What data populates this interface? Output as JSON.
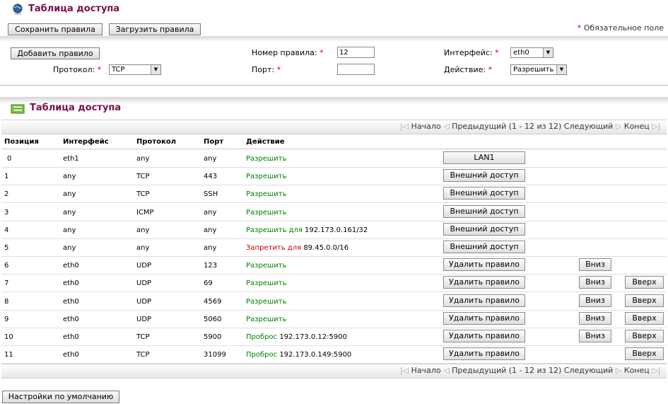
{
  "header": {
    "title": "Таблица доступа",
    "save_label": "Сохранить правила",
    "load_label": "Загрузить правила",
    "required_note": "Обязательное поле"
  },
  "form": {
    "add_label": "Добавить правило",
    "rule_number_label": "Номер правила:",
    "rule_number_value": "12",
    "interface_label": "Интерфейс:",
    "interface_value": "eth0",
    "protocol_label": "Протокол:",
    "protocol_value": "TCP",
    "port_label": "Порт:",
    "port_value": "",
    "action_label": "Действие:",
    "action_value": "Разрешить"
  },
  "table": {
    "title": "Таблица доступа",
    "pager": {
      "first": "Начало",
      "prev": "Предыдущий",
      "range": "(1 - 12 из 12)",
      "next": "Следующий",
      "last": "Конец"
    },
    "columns": [
      "Позиция",
      "Интерфейс",
      "Протокол",
      "Порт",
      "Действие"
    ],
    "rows": [
      {
        "pos": "0",
        "iface": "eth1",
        "proto": "any",
        "port": "any",
        "action": "Разрешить",
        "detail": "",
        "deny": false,
        "main_btn": "LAN1",
        "down": "",
        "up": ""
      },
      {
        "pos": "1",
        "iface": "any",
        "proto": "TCP",
        "port": "443",
        "action": "Разрешить",
        "detail": "",
        "deny": false,
        "main_btn": "Внешний доступ",
        "down": "",
        "up": ""
      },
      {
        "pos": "2",
        "iface": "any",
        "proto": "TCP",
        "port": "SSH",
        "action": "Разрешить",
        "detail": "",
        "deny": false,
        "main_btn": "Внешний доступ",
        "down": "",
        "up": ""
      },
      {
        "pos": "3",
        "iface": "any",
        "proto": "ICMP",
        "port": "any",
        "action": "Разрешить",
        "detail": "",
        "deny": false,
        "main_btn": "Внешний доступ",
        "down": "",
        "up": ""
      },
      {
        "pos": "4",
        "iface": "any",
        "proto": "any",
        "port": "any",
        "action": "Разрешить для",
        "detail": "192.173.0.161/32",
        "deny": false,
        "main_btn": "Внешний доступ",
        "down": "",
        "up": ""
      },
      {
        "pos": "5",
        "iface": "any",
        "proto": "any",
        "port": "any",
        "action": "Запретить для",
        "detail": "89.45.0.0/16",
        "deny": true,
        "main_btn": "Внешний доступ",
        "down": "",
        "up": ""
      },
      {
        "pos": "6",
        "iface": "eth0",
        "proto": "UDP",
        "port": "123",
        "action": "Разрешить",
        "detail": "",
        "deny": false,
        "main_btn": "Удалить правило",
        "down": "Вниз",
        "up": ""
      },
      {
        "pos": "7",
        "iface": "eth0",
        "proto": "UDP",
        "port": "69",
        "action": "Разрешить",
        "detail": "",
        "deny": false,
        "main_btn": "Удалить правило",
        "down": "Вниз",
        "up": "Вверх"
      },
      {
        "pos": "8",
        "iface": "eth0",
        "proto": "UDP",
        "port": "4569",
        "action": "Разрешить",
        "detail": "",
        "deny": false,
        "main_btn": "Удалить правило",
        "down": "Вниз",
        "up": "Вверх"
      },
      {
        "pos": "9",
        "iface": "eth0",
        "proto": "UDP",
        "port": "5060",
        "action": "Разрешить",
        "detail": "",
        "deny": false,
        "main_btn": "Удалить правило",
        "down": "Вниз",
        "up": "Вверх"
      },
      {
        "pos": "10",
        "iface": "eth0",
        "proto": "TCP",
        "port": "5900",
        "action": "Проброс",
        "detail": "192.173.0.12:5900",
        "deny": false,
        "main_btn": "Удалить правило",
        "down": "Вниз",
        "up": "Вверх"
      },
      {
        "pos": "11",
        "iface": "eth0",
        "proto": "TCP",
        "port": "31099",
        "action": "Проброс",
        "detail": "192.173.0.149:5900",
        "deny": false,
        "main_btn": "Удалить правило",
        "down": "",
        "up": "Вверх"
      }
    ]
  },
  "footer": {
    "defaults_label": "Настройки по умолчанию"
  }
}
